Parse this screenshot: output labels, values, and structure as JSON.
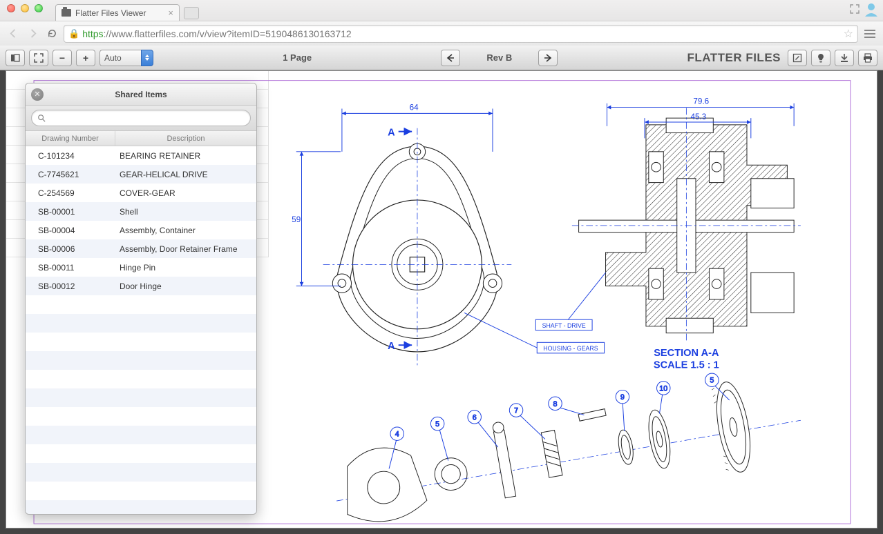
{
  "browser": {
    "tab_title": "Flatter Files Viewer",
    "url_https": "https",
    "url_rest": "://www.flatterfiles.com/v/view?itemID=5190486130163712"
  },
  "toolbar": {
    "zoom_value": "Auto",
    "page_label": "1 Page",
    "rev_label": "Rev B",
    "brand": "FLATTER FILES"
  },
  "panel": {
    "title": "Shared Items",
    "search_placeholder": "",
    "columns": {
      "num": "Drawing Number",
      "desc": "Description"
    },
    "rows": [
      {
        "num": "C-101234",
        "desc": "BEARING RETAINER"
      },
      {
        "num": "C-7745621",
        "desc": "GEAR-HELICAL DRIVE"
      },
      {
        "num": "C-254569",
        "desc": "COVER-GEAR"
      },
      {
        "num": "SB-00001",
        "desc": "Shell"
      },
      {
        "num": "SB-00004",
        "desc": "Assembly, Container"
      },
      {
        "num": "SB-00006",
        "desc": "Assembly, Door Retainer Frame"
      },
      {
        "num": "SB-00011",
        "desc": "Hinge Pin"
      },
      {
        "num": "SB-00012",
        "desc": "Door Hinge"
      }
    ]
  },
  "drawing": {
    "dim_top_left": "64",
    "dim_side_left": "59",
    "dim_top_right": "79.6",
    "dim_sub_right": "45.3",
    "marker_a1": "A",
    "marker_a2": "A",
    "label_housing": "HOUSING - GEARS",
    "label_shaft": "SHAFT - DRIVE",
    "section_title1": "SECTION A-A",
    "section_title2": "SCALE 1.5 : 1",
    "balloon_4": "4",
    "balloon_5a": "5",
    "balloon_5b": "5",
    "balloon_6": "6",
    "balloon_7": "7",
    "balloon_8": "8",
    "balloon_9": "9",
    "balloon_10": "10"
  }
}
